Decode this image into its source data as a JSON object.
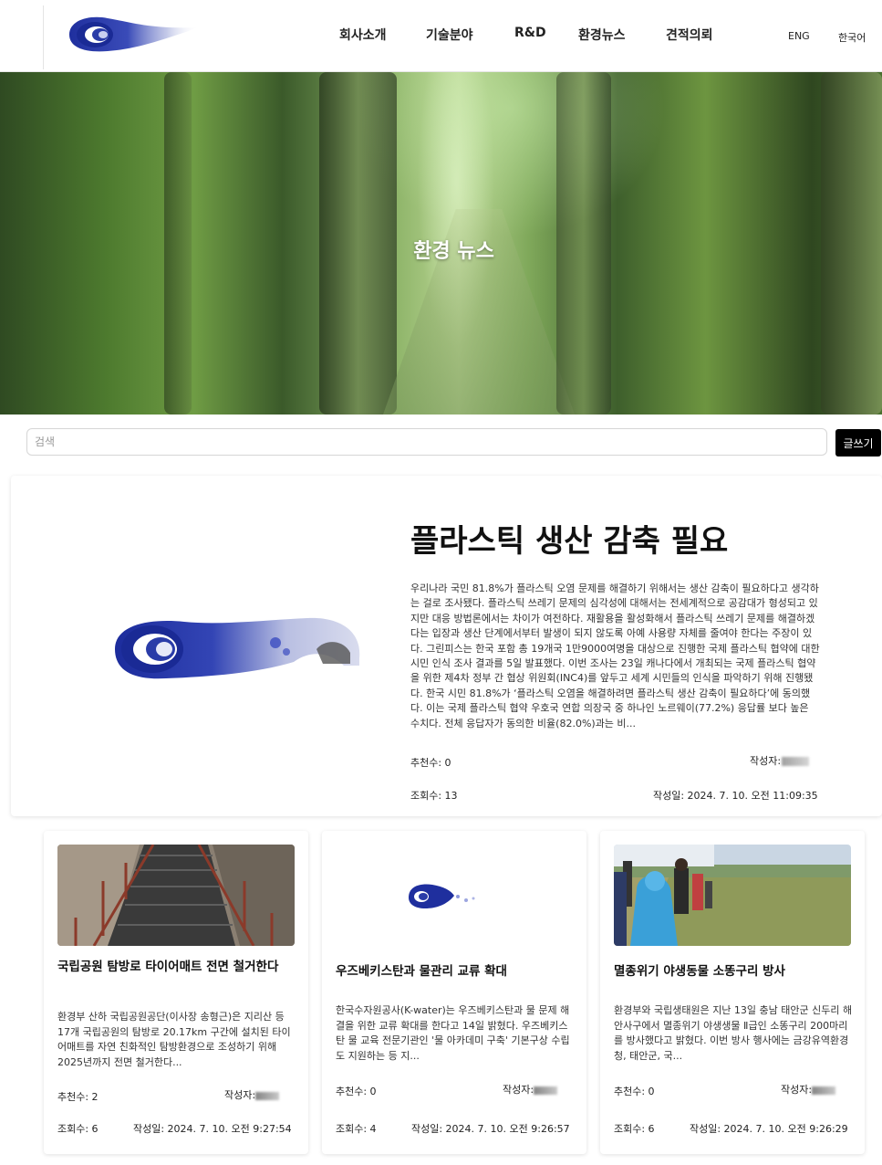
{
  "header": {
    "nav": [
      {
        "label": "회사소개"
      },
      {
        "label": "기술분야"
      },
      {
        "label": "R&D"
      },
      {
        "label": "환경뉴스"
      },
      {
        "label": "견적의뢰"
      }
    ],
    "lang": {
      "eng": "ENG",
      "kor": "한국어"
    }
  },
  "hero": {
    "title": "환경 뉴스"
  },
  "search": {
    "placeholder": "검색",
    "write_label": "글쓰기"
  },
  "featured": {
    "title": "플라스틱 생산 감축 필요",
    "body": "우리나라 국민 81.8%가 플라스틱 오염 문제를 해결하기 위해서는 생산 감축이 필요하다고 생각하는 걸로 조사됐다. 플라스틱 쓰레기 문제의 심각성에 대해서는 전세계적으로 공감대가 형성되고 있지만 대응 방법론에서는 차이가 여전하다. 재활용을 활성화해서 플라스틱 쓰레기 문제를 해결하겠다는 입장과 생산 단계에서부터 발생이 되지 않도록 아예 사용량 자체를 줄여야 한다는 주장이 있다. 그린피스는 한국 포함 총 19개국 1만9000여명을 대상으로 진행한 국제 플라스틱 협약에 대한 시민 인식 조사 결과를 5일 발표했다. 이번 조사는 23일 캐나다에서 개최되는 국제 플라스틱 협약을 위한 제4차 정부 간 협상 위원회(INC4)를 앞두고 세계 시민들의 인식을 파악하기 위해 진행됐다. 한국 시민 81.8%가 ‘플라스틱 오염을 해결하려면 플라스틱 생산 감축이 필요하다’에 동의했다. 이는 국제 플라스틱 협약 우호국 연합 의장국 중 하나인 노르웨이(77.2%) 응답률 보다 높은 수치다. 전체 응답자가 동의한 비율(82.0%)과는 비...",
    "recommend": "추천수: 0",
    "author": "작성자:",
    "views": "조회수: 13",
    "date": "작성일: 2024. 7. 10. 오전 11:09:35"
  },
  "cards": [
    {
      "title": "국립공원 탐방로 타이어매트 전면 철거한다",
      "body": "환경부 산하 국립공원공단(이사장 송형근)은 지리산 등 17개 국립공원의 탐방로 20.17km 구간에 설치된 타이어매트를 자연 친화적인 탐방환경으로 조성하기 위해 2025년까지 전면 철거한다...",
      "recommend": "추천수: 2",
      "author": "작성자:",
      "views": "조회수: 6",
      "date": "작성일: 2024. 7. 10. 오전 9:27:54"
    },
    {
      "title": "우즈베키스탄과 물관리 교류 확대",
      "body": "한국수자원공사(K-water)는 우즈베키스탄과 물 문제 해결을 위한 교류 확대를 한다고 14일 밝혔다. 우즈베키스탄 물 교육 전문기관인 '물 아카데미 구축' 기본구상 수립도 지원하는 등 지...",
      "recommend": "추천수: 0",
      "author": "작성자:",
      "views": "조회수: 4",
      "date": "작성일: 2024. 7. 10. 오전 9:26:57"
    },
    {
      "title": "멸종위기 야생동물 소똥구리 방사",
      "body": "환경부와 국립생태원은 지난 13일 충남 태안군 신두리 해안사구에서 멸종위기 야생생물 Ⅱ급인 소똥구리 200마리를 방사했다고 밝혔다. 이번 방사 행사에는 금강유역환경청, 태안군, 국...",
      "recommend": "추천수: 0",
      "author": "작성자:",
      "views": "조회수: 6",
      "date": "작성일: 2024. 7. 10. 오전 9:26:29"
    }
  ]
}
